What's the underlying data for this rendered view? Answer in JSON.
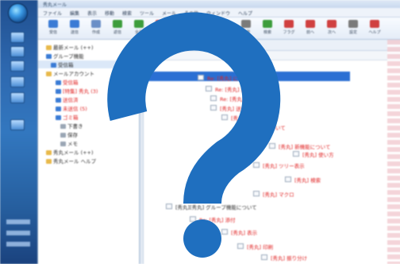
{
  "window": {
    "title": "秀丸メール"
  },
  "menu": [
    "ファイル",
    "編集",
    "表示",
    "移動",
    "検索",
    "ツール",
    "メール",
    "その他",
    "ウィンドウ",
    "ヘルプ"
  ],
  "toolbar": [
    {
      "label": "受信",
      "color": "#3a7bd5"
    },
    {
      "label": "送信",
      "color": "#3a7bd5"
    },
    {
      "label": "作成",
      "color": "#6a8fc7"
    },
    {
      "label": "返信",
      "color": "#3c9d3c"
    },
    {
      "label": "全員",
      "color": "#3c9d3c"
    },
    {
      "label": "転送",
      "color": "#d04040"
    },
    {
      "label": "削除",
      "color": "#d04040"
    },
    {
      "label": "移動",
      "color": "#a06a2a"
    },
    {
      "label": "既読",
      "color": "#3a7bd5"
    },
    {
      "label": "印刷",
      "color": "#7a7a7a"
    },
    {
      "label": "検索",
      "color": "#3c9d3c"
    },
    {
      "label": "フラグ",
      "color": "#d04040"
    },
    {
      "label": "前へ",
      "color": "#d04040"
    },
    {
      "label": "次へ",
      "color": "#d04040"
    },
    {
      "label": "設定",
      "color": "#7a7a7a"
    },
    {
      "label": "ヘルプ",
      "color": "#d04040"
    }
  ],
  "tree": [
    {
      "label": "最新メール (++)",
      "color": "#2a2a2a",
      "icon": "#e8b94a"
    },
    {
      "label": "グループ機能",
      "color": "#2a2a2a",
      "icon": "#3a7bd5"
    },
    {
      "label": "受信箱",
      "color": "#2a2a2a",
      "icon": "#3a7bd5"
    },
    {
      "label": "メールアカウント",
      "color": "#2a2a2a",
      "icon": "#e8b94a"
    },
    {
      "label": "受信箱",
      "color": "#e02020",
      "icon": "#3a7bd5"
    },
    {
      "label": "[特集] 秀丸 (3)",
      "color": "#e02020",
      "icon": "#3a7bd5"
    },
    {
      "label": "送信済",
      "color": "#e02020",
      "icon": "#3a7bd5"
    },
    {
      "label": "未送信 (5)",
      "color": "#e02020",
      "icon": "#3a7bd5"
    },
    {
      "label": "ゴミ箱",
      "color": "#e02020",
      "icon": "#3a7bd5"
    },
    {
      "label": "下書き",
      "color": "#2a2a2a",
      "icon": "#9aa6b5"
    },
    {
      "label": "保存",
      "color": "#2a2a2a",
      "icon": "#9aa6b5"
    },
    {
      "label": "メモ",
      "color": "#2a2a2a",
      "icon": "#9aa6b5"
    },
    {
      "label": "秀丸メール (++)",
      "color": "#2a2a2a",
      "icon": "#e8b94a"
    },
    {
      "label": "秀丸メール ヘルプ",
      "color": "#2a2a2a",
      "icon": "#e8b94a"
    }
  ],
  "messages": [
    {
      "text": "Re: [秀丸] について",
      "style": "red"
    },
    {
      "text": "Re: [秀丸] 設定",
      "style": "red"
    },
    {
      "text": "Re: [秀丸] 質問",
      "style": "red"
    },
    {
      "text": "[秀丸] 送信エラー",
      "style": "red"
    },
    {
      "text": "[秀丸] フォルダ機能",
      "style": "red"
    },
    {
      "text": "設定について",
      "style": "red"
    },
    {
      "text": "[秀丸] 新機能について",
      "style": "red"
    },
    {
      "text": "[秀丸] 使い方",
      "style": "red"
    },
    {
      "text": "[秀丸] ツリー表示",
      "style": "red"
    },
    {
      "text": "[秀丸] 検索",
      "style": "red"
    },
    {
      "text": "[秀丸] マクロ",
      "style": "red"
    },
    {
      "text": "[秀丸][秀丸] グループ機能について",
      "style": "dark"
    },
    {
      "text": "Re: [秀丸] 添付",
      "style": "red"
    },
    {
      "text": "[秀丸] 表示",
      "style": "red"
    },
    {
      "text": "[秀丸] 印刷",
      "style": "red"
    },
    {
      "text": "[秀丸] 振り分け",
      "style": "red"
    }
  ],
  "overlay": {
    "glyph": "?",
    "color": "#1f6fbf"
  }
}
